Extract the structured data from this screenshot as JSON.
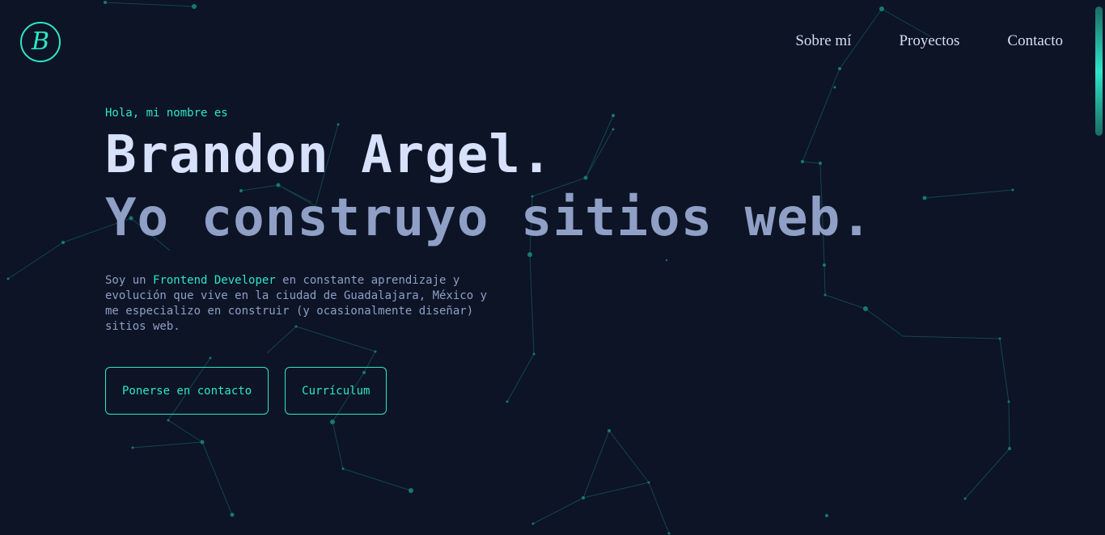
{
  "logo": {
    "letter": "B"
  },
  "nav": {
    "items": [
      "Sobre mí",
      "Proyectos",
      "Contacto"
    ]
  },
  "hero": {
    "greeting": "Hola, mi nombre es",
    "name": "Brandon Argel.",
    "tagline": "Yo construyo sitios web.",
    "intro": {
      "before": "Soy un ",
      "highlight": "Frontend Developer",
      "after": " en constante aprendizaje y evolución que vive en la ciudad de Guadalajara, México y me especializo en construir (y ocasionalmente diseñar) sitios web."
    },
    "buttons": {
      "contact": "Ponerse en contacto",
      "resume": "Currículum"
    }
  },
  "colors": {
    "background": "#0c1426",
    "accent": "#2ee6c9",
    "heading": "#d8e1fb",
    "muted": "#8f9fc5"
  }
}
